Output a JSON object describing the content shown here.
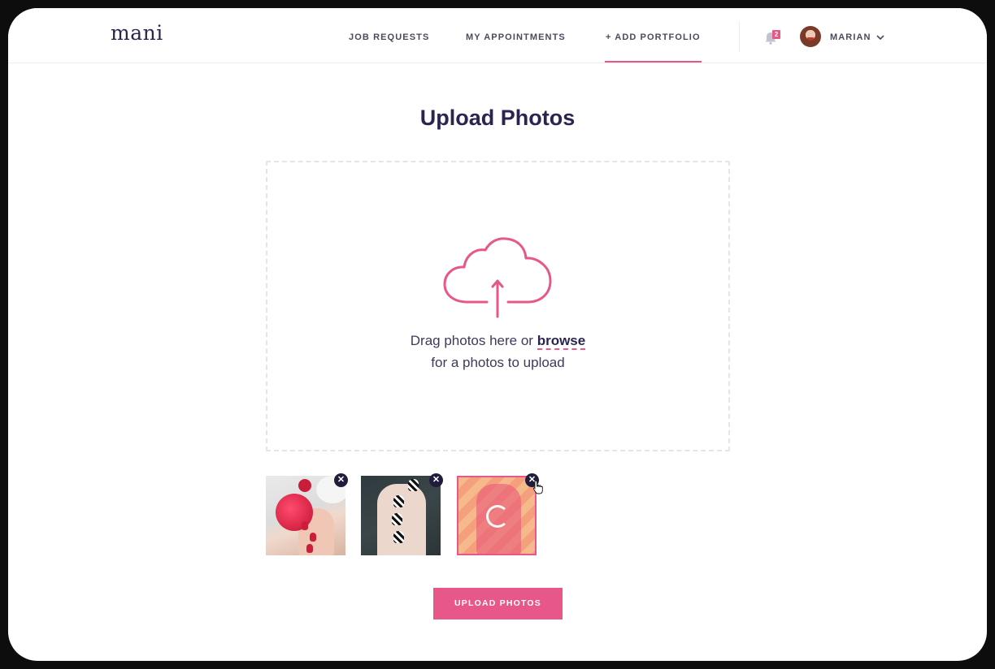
{
  "app": {
    "logo": "mani"
  },
  "nav": {
    "items": [
      {
        "label": "JOB REQUESTS"
      },
      {
        "label": "MY APPOINTMENTS"
      },
      {
        "label": "+ ADD PORTFOLIO",
        "active": true
      }
    ],
    "notification_count": "2",
    "user_name": "MARIAN"
  },
  "page": {
    "title": "Upload Photos"
  },
  "dropzone": {
    "line1_prefix": "Drag photos here or ",
    "browse_label": "browse",
    "line2": "for a photos to upload"
  },
  "thumbnails": [
    {
      "icon": "cupcake-manicure-photo",
      "status": "uploaded"
    },
    {
      "icon": "patterned-nails-photo",
      "status": "uploaded"
    },
    {
      "icon": "manicure-photo",
      "status": "uploading"
    }
  ],
  "actions": {
    "upload_label": "UPLOAD PHOTOS"
  },
  "colors": {
    "accent": "#e8578a",
    "brand": "#2a2550"
  }
}
